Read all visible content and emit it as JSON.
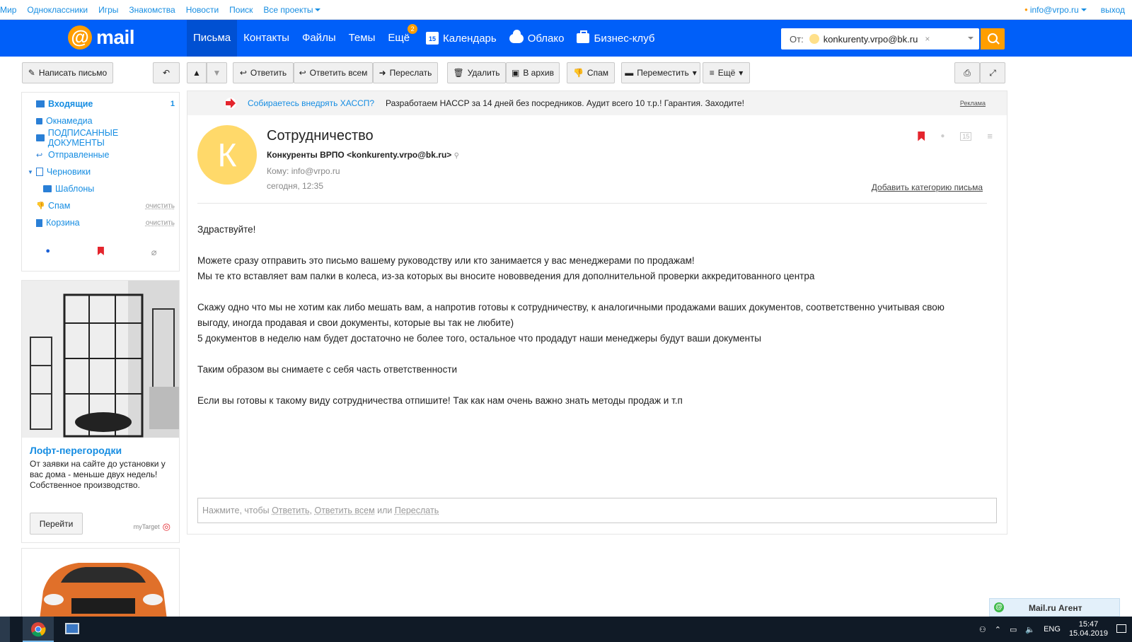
{
  "portal": {
    "left_links": [
      "Мир",
      "Одноклассники",
      "Игры",
      "Знакомства",
      "Новости",
      "Поиск",
      "Все проекты"
    ],
    "user": "info@vrpo.ru",
    "logout": "выход"
  },
  "header": {
    "logo_text": "mail",
    "nav": [
      "Письма",
      "Контакты",
      "Файлы",
      "Темы",
      "Ещё"
    ],
    "more_badge": "2",
    "nav2": [
      "Календарь",
      "Облако",
      "Бизнес-клуб"
    ],
    "calendar_day": "15",
    "search_label": "От:",
    "search_value": "konkurenty.vrpo@bk.ru"
  },
  "toolbar": {
    "compose": "Написать письмо",
    "reply": "Ответить",
    "reply_all": "Ответить всем",
    "forward": "Переслать",
    "delete": "Удалить",
    "archive": "В архив",
    "spam": "Спам",
    "move": "Переместить",
    "more": "Ещё"
  },
  "folders": [
    {
      "label": "Входящие",
      "count": "1"
    },
    {
      "label": "Окнамедиа"
    },
    {
      "label": "ПОДПИСАННЫЕ ДОКУМЕНТЫ"
    },
    {
      "label": "Отправленные"
    },
    {
      "label": "Черновики"
    },
    {
      "label": "Шаблоны"
    },
    {
      "label": "Спам",
      "action": "очистить"
    },
    {
      "label": "Корзина",
      "action": "очистить"
    }
  ],
  "ad": {
    "title": "Лофт-перегородки",
    "desc": "От заявки на сайте до установки у вас дома - меньше двух недель! Собственное производство.",
    "button": "Перейти",
    "brand": "myTarget"
  },
  "adline": {
    "link": "Собираетесь внедрять ХАССП?",
    "text": "Разработаем HACCP за 14 дней без посредников. Аудит всего 10 т.р.! Гарантия. Заходите!",
    "tag": "Реклама"
  },
  "message": {
    "avatar_letter": "К",
    "subject": "Сотрудничество",
    "from": "Конкуренты ВРПО <konkurenty.vrpo@bk.ru>",
    "to": "Кому: info@vrpo.ru",
    "date": "сегодня, 12:35",
    "add_category": "Добавить категорию письма",
    "body": {
      "greeting": "Здраствуйте!",
      "p1_l1": "Можете сразу отправить это письмо вашему руководству или кто занимается у вас менеджерами по продажам!",
      "p1_l2": "Мы те кто вставляет вам палки в колеса, из-за которых вы вносите нововведения для дополнительной проверки аккредитованного центра",
      "p2_l1": "Скажу одно что мы не хотим как либо мешать вам, а напротив готовы к сотрудничеству, к аналогичными продажами ваших документов, соответственно учитывая свою",
      "p2_l2": "выгоду, иногда продавая и свои документы, которые вы так не любите)",
      "p2_l3": "5 документов в неделю нам будет достаточно не более того, остальное что продадут наши менеджеры будут ваши документы",
      "p3": "Таким образом вы снимаете с себя часть ответственности",
      "p4": "Если вы готовы к такому виду сотрудничества отпишите! Так как нам очень важно знать методы продаж и т.п"
    },
    "reply_prompt": "Нажмите, чтобы",
    "reply_link": "Ответить",
    "reply_all_link": "Ответить всем",
    "or": "или",
    "forward_link": "Переслать"
  },
  "agent": "Mail.ru Агент",
  "taskbar": {
    "lang": "ENG",
    "time": "15:47",
    "date": "15.04.2019"
  },
  "colors": {
    "header_blue": "#005ff9",
    "accent_orange": "#ff9e00",
    "link_blue": "#168de2",
    "flag_red": "#e4252d"
  }
}
